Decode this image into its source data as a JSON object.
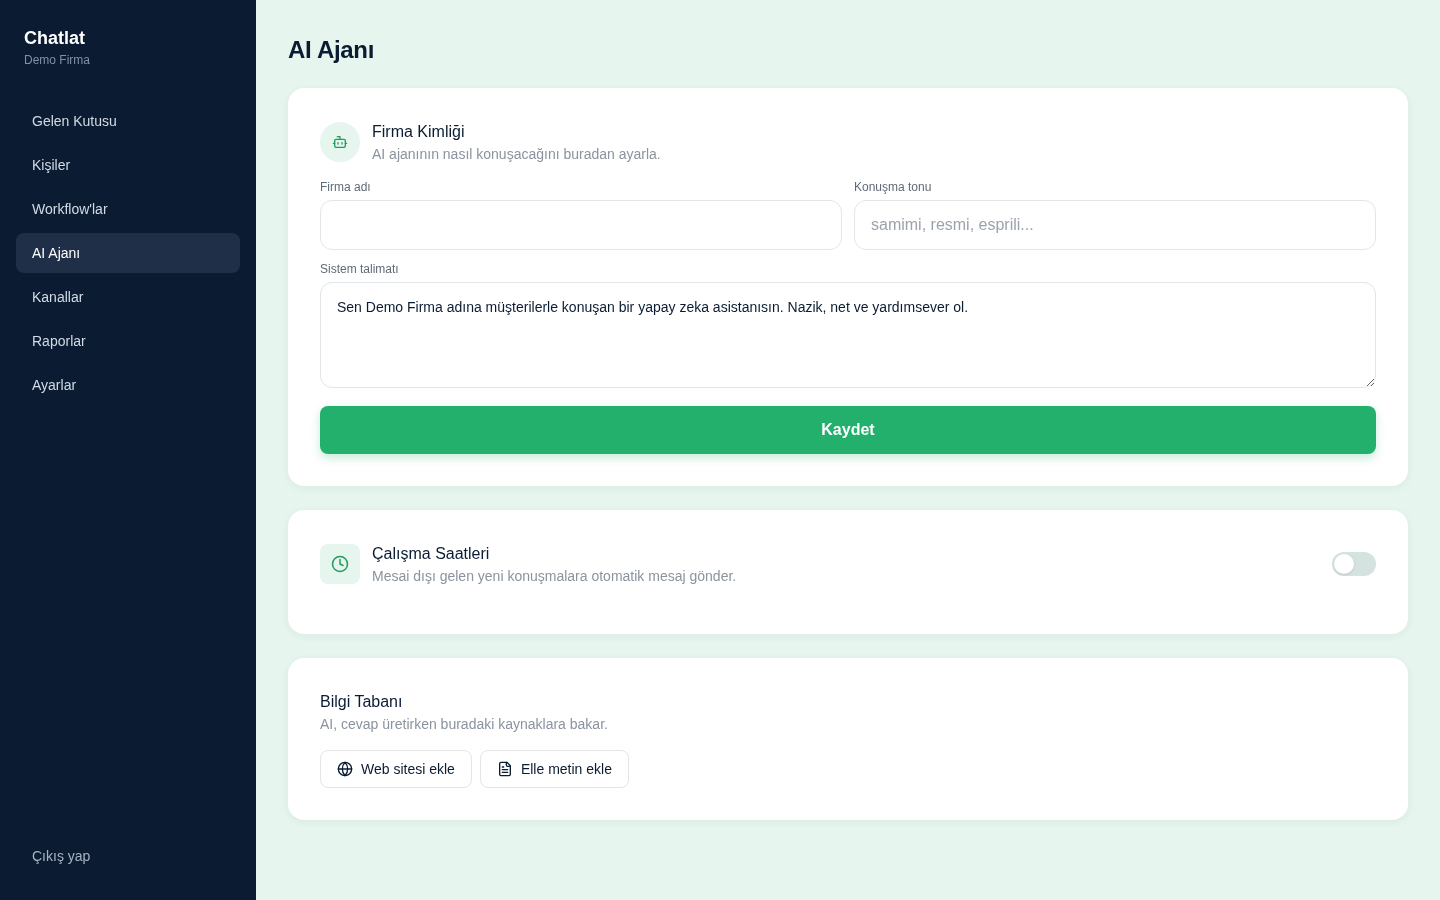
{
  "sidebar": {
    "brand": "Chatlat",
    "workspace": "Demo Firma",
    "items": [
      {
        "label": "Gelen Kutusu",
        "selected": false
      },
      {
        "label": "Kişiler",
        "selected": false
      },
      {
        "label": "Workflow'lar",
        "selected": false
      },
      {
        "label": "AI Ajanı",
        "selected": true
      },
      {
        "label": "Kanallar",
        "selected": false
      },
      {
        "label": "Raporlar",
        "selected": false
      },
      {
        "label": "Ayarlar",
        "selected": false
      }
    ],
    "logout": "Çıkış yap"
  },
  "page_title": "AI Ajanı",
  "sections": [
    {
      "kind": "form",
      "title": "Firma Kimliği",
      "subtitle": "AI ajanının nasıl konuşacağını buradan ayarla.",
      "fields": [
        {
          "kind": "input",
          "label": "Firma adı"
        },
        {
          "kind": "input",
          "label": "Konuşma tonu",
          "placeholder": "samimi, resmi, esprili..."
        },
        {
          "kind": "textarea",
          "label": "Sistem talimatı",
          "value": "Sen Demo Firma adına müşterilerle konuşan bir yapay zeka asistanısın. Nazik, net ve yardımsever ol."
        }
      ],
      "submit": "Kaydet"
    },
    {
      "kind": "toggle",
      "title": "Çalışma Saatleri",
      "subtitle": "Mesai dışı gelen yeni konuşmalara otomatik mesaj gönder.",
      "on": false
    },
    {
      "kind": "sources",
      "title": "Bilgi Tabanı",
      "subtitle": "AI, cevap üretirken buradaki kaynaklara bakar.",
      "buttons": [
        {
          "kind": "website",
          "label": "Web sitesi ekle"
        },
        {
          "kind": "text",
          "label": "Elle metin ekle"
        }
      ]
    }
  ]
}
